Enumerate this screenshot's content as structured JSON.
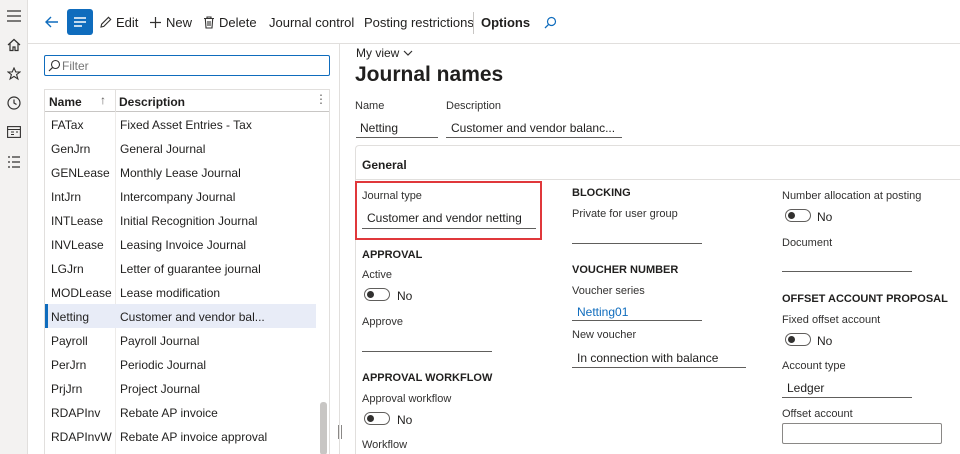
{
  "toolbar": {
    "edit": "Edit",
    "new": "New",
    "delete": "Delete",
    "journal_control": "Journal control",
    "posting_restrictions": "Posting restrictions",
    "options": "Options"
  },
  "list": {
    "filter_placeholder": "Filter",
    "col_name": "Name",
    "col_description": "Description",
    "rows": [
      {
        "name": "FATax",
        "description": "Fixed Asset Entries - Tax"
      },
      {
        "name": "GenJrn",
        "description": "General Journal"
      },
      {
        "name": "GENLease",
        "description": "Monthly Lease Journal"
      },
      {
        "name": "IntJrn",
        "description": "Intercompany Journal"
      },
      {
        "name": "INTLease",
        "description": "Initial Recognition Journal"
      },
      {
        "name": "INVLease",
        "description": "Leasing Invoice Journal"
      },
      {
        "name": "LGJrn",
        "description": "Letter of guarantee journal"
      },
      {
        "name": "MODLease",
        "description": "Lease modification"
      },
      {
        "name": "Netting",
        "description": "Customer and vendor bal..."
      },
      {
        "name": "Payroll",
        "description": "Payroll Journal"
      },
      {
        "name": "PerJrn",
        "description": "Periodic Journal"
      },
      {
        "name": "PrjJrn",
        "description": "Project Journal"
      },
      {
        "name": "RDAPInv",
        "description": "Rebate AP invoice"
      },
      {
        "name": "RDAPInvW",
        "description": "Rebate AP invoice approval"
      }
    ]
  },
  "detail": {
    "view": "My view",
    "title": "Journal names",
    "name_label": "Name",
    "name_value": "Netting",
    "description_label": "Description",
    "description_value": "Customer and vendor balanc...",
    "section_title": "General",
    "journal_type_label": "Journal type",
    "journal_type_value": "Customer and vendor netting",
    "approval_header": "APPROVAL",
    "active_label": "Active",
    "active_value": "No",
    "approve_label": "Approve",
    "approval_workflow_header": "APPROVAL WORKFLOW",
    "approval_workflow_label": "Approval workflow",
    "approval_workflow_value": "No",
    "workflow_label": "Workflow",
    "blocking_header": "BLOCKING",
    "private_label": "Private for user group",
    "voucher_header": "VOUCHER NUMBER",
    "voucher_series_label": "Voucher series",
    "voucher_series_value": "Netting01",
    "new_voucher_label": "New voucher",
    "new_voucher_value": "In connection with balance",
    "number_allocation_label": "Number allocation at posting",
    "number_allocation_value": "No",
    "document_label": "Document",
    "offset_header": "OFFSET ACCOUNT PROPOSAL",
    "fixed_offset_label": "Fixed offset account",
    "fixed_offset_value": "No",
    "account_type_label": "Account type",
    "account_type_value": "Ledger",
    "offset_account_label": "Offset account"
  },
  "colors": {
    "accent": "#0f6cbd",
    "highlight": "#e0383b",
    "selected_row": "#e8ecf7"
  }
}
